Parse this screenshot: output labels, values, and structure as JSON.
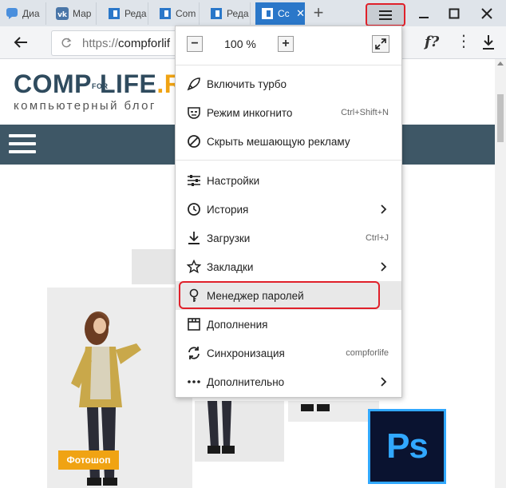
{
  "tabs": [
    {
      "label": "Диа",
      "icon": "chat-icon",
      "active": false
    },
    {
      "label": "Мар",
      "icon": "vk-icon",
      "active": false
    },
    {
      "label": "Реда",
      "icon": "compforlife-favicon",
      "active": false
    },
    {
      "label": "Com",
      "icon": "compforlife-favicon",
      "active": false
    },
    {
      "label": "Реда",
      "icon": "compforlife-favicon",
      "active": false
    },
    {
      "label": "Сс",
      "icon": "compforlife-favicon",
      "active": true
    }
  ],
  "address": {
    "scheme": "https://",
    "host": "compforlif"
  },
  "site": {
    "logo_part1": "COMP",
    "logo_for": "FOR",
    "logo_part2": "LIFE",
    "logo_part3": ".RU",
    "tagline": "компьютерный блог",
    "category_tag": "Фотошоп",
    "ps_logo_text": "Ps"
  },
  "menu": {
    "zoom_minus": "−",
    "zoom_value": "100 %",
    "zoom_plus": "+",
    "items": [
      {
        "label": "Включить турбо",
        "icon": "rocket-icon",
        "hint": "",
        "has_arrow": false
      },
      {
        "label": "Режим инкогнито",
        "icon": "incognito-icon",
        "hint": "Ctrl+Shift+N",
        "has_arrow": false
      },
      {
        "label": "Скрыть мешающую рекламу",
        "icon": "block-icon",
        "hint": "",
        "has_arrow": false
      },
      {
        "label": "Настройки",
        "icon": "settings-sliders-icon",
        "hint": "",
        "has_arrow": false
      },
      {
        "label": "История",
        "icon": "clock-icon",
        "hint": "",
        "has_arrow": true
      },
      {
        "label": "Загрузки",
        "icon": "download-icon",
        "hint": "Ctrl+J",
        "has_arrow": false
      },
      {
        "label": "Закладки",
        "icon": "star-icon",
        "hint": "",
        "has_arrow": true
      },
      {
        "label": "Менеджер паролей",
        "icon": "key-icon",
        "hint": "",
        "has_arrow": false
      },
      {
        "label": "Дополнения",
        "icon": "extensions-icon",
        "hint": "",
        "has_arrow": false
      },
      {
        "label": "Синхронизация",
        "icon": "sync-icon",
        "hint": "compforlife",
        "has_arrow": false
      },
      {
        "label": "Дополнительно",
        "icon": "more-dots-icon",
        "hint": "",
        "has_arrow": true
      }
    ]
  },
  "colors": {
    "accent_red": "#e0202a",
    "tab_active": "#2a77c9",
    "site_nav": "#3e5766",
    "logo_accent": "#f0a313"
  }
}
